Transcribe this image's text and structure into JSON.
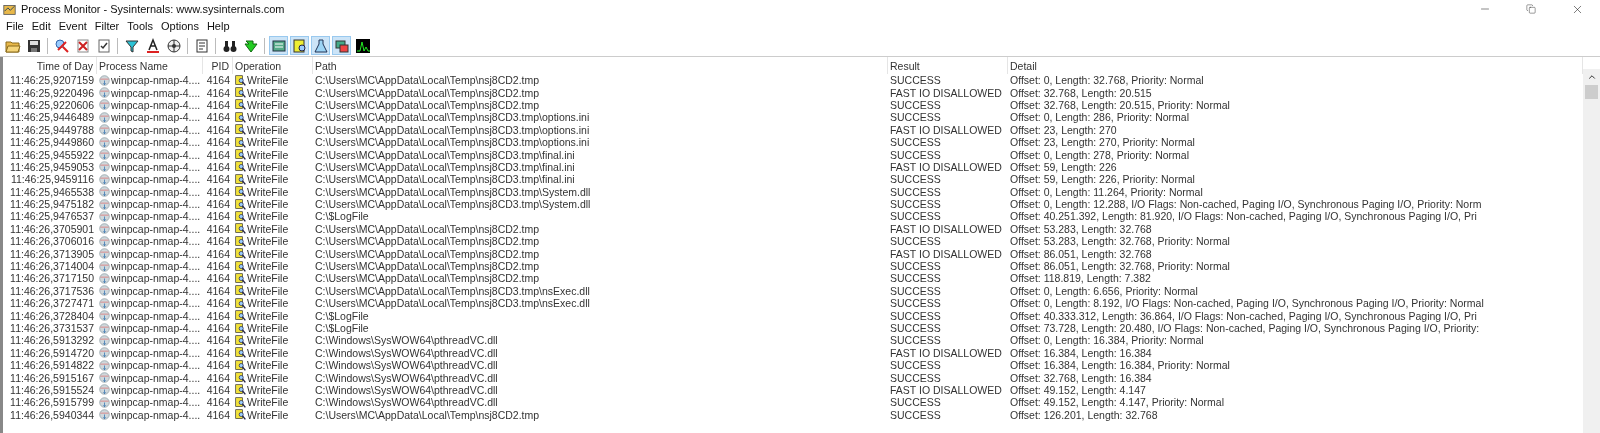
{
  "window": {
    "title": "Process Monitor - Sysinternals: www.sysinternals.com"
  },
  "menu": [
    "File",
    "Edit",
    "Event",
    "Filter",
    "Tools",
    "Options",
    "Help"
  ],
  "event_class_filters": [
    {
      "selected": true
    },
    {
      "selected": true
    },
    {
      "selected": true
    },
    {
      "selected": true
    },
    {
      "selected": false
    }
  ],
  "table": {
    "columns": [
      "Time of Day",
      "Process Name",
      "PID",
      "Operation",
      "Path",
      "Result",
      "Detail"
    ],
    "rows": [
      {
        "time": "11:46:25,9207159",
        "process": "winpcap-nmap-4....",
        "pid": "4164",
        "operation": "WriteFile",
        "path": "C:\\Users\\MC\\AppData\\Local\\Temp\\nsj8CD2.tmp",
        "result": "SUCCESS",
        "detail": "Offset: 0, Length: 32.768, Priority: Normal"
      },
      {
        "time": "11:46:25,9220496",
        "process": "winpcap-nmap-4....",
        "pid": "4164",
        "operation": "WriteFile",
        "path": "C:\\Users\\MC\\AppData\\Local\\Temp\\nsj8CD2.tmp",
        "result": "FAST IO DISALLOWED",
        "detail": "Offset: 32.768, Length: 20.515"
      },
      {
        "time": "11:46:25,9220606",
        "process": "winpcap-nmap-4....",
        "pid": "4164",
        "operation": "WriteFile",
        "path": "C:\\Users\\MC\\AppData\\Local\\Temp\\nsj8CD2.tmp",
        "result": "SUCCESS",
        "detail": "Offset: 32.768, Length: 20.515, Priority: Normal"
      },
      {
        "time": "11:46:25,9446489",
        "process": "winpcap-nmap-4....",
        "pid": "4164",
        "operation": "WriteFile",
        "path": "C:\\Users\\MC\\AppData\\Local\\Temp\\nsj8CD3.tmp\\options.ini",
        "result": "SUCCESS",
        "detail": "Offset: 0, Length: 286, Priority: Normal"
      },
      {
        "time": "11:46:25,9449788",
        "process": "winpcap-nmap-4....",
        "pid": "4164",
        "operation": "WriteFile",
        "path": "C:\\Users\\MC\\AppData\\Local\\Temp\\nsj8CD3.tmp\\options.ini",
        "result": "FAST IO DISALLOWED",
        "detail": "Offset: 23, Length: 270"
      },
      {
        "time": "11:46:25,9449860",
        "process": "winpcap-nmap-4....",
        "pid": "4164",
        "operation": "WriteFile",
        "path": "C:\\Users\\MC\\AppData\\Local\\Temp\\nsj8CD3.tmp\\options.ini",
        "result": "SUCCESS",
        "detail": "Offset: 23, Length: 270, Priority: Normal"
      },
      {
        "time": "11:46:25,9455922",
        "process": "winpcap-nmap-4....",
        "pid": "4164",
        "operation": "WriteFile",
        "path": "C:\\Users\\MC\\AppData\\Local\\Temp\\nsj8CD3.tmp\\final.ini",
        "result": "SUCCESS",
        "detail": "Offset: 0, Length: 278, Priority: Normal"
      },
      {
        "time": "11:46:25,9459053",
        "process": "winpcap-nmap-4....",
        "pid": "4164",
        "operation": "WriteFile",
        "path": "C:\\Users\\MC\\AppData\\Local\\Temp\\nsj8CD3.tmp\\final.ini",
        "result": "FAST IO DISALLOWED",
        "detail": "Offset: 59, Length: 226"
      },
      {
        "time": "11:46:25,9459116",
        "process": "winpcap-nmap-4....",
        "pid": "4164",
        "operation": "WriteFile",
        "path": "C:\\Users\\MC\\AppData\\Local\\Temp\\nsj8CD3.tmp\\final.ini",
        "result": "SUCCESS",
        "detail": "Offset: 59, Length: 226, Priority: Normal"
      },
      {
        "time": "11:46:25,9465538",
        "process": "winpcap-nmap-4....",
        "pid": "4164",
        "operation": "WriteFile",
        "path": "C:\\Users\\MC\\AppData\\Local\\Temp\\nsj8CD3.tmp\\System.dll",
        "result": "SUCCESS",
        "detail": "Offset: 0, Length: 11.264, Priority: Normal"
      },
      {
        "time": "11:46:25,9475182",
        "process": "winpcap-nmap-4....",
        "pid": "4164",
        "operation": "WriteFile",
        "path": "C:\\Users\\MC\\AppData\\Local\\Temp\\nsj8CD3.tmp\\System.dll",
        "result": "SUCCESS",
        "detail": "Offset: 0, Length: 12.288, I/O Flags: Non-cached, Paging I/O, Synchronous Paging I/O, Priority: Norm"
      },
      {
        "time": "11:46:25,9476537",
        "process": "winpcap-nmap-4....",
        "pid": "4164",
        "operation": "WriteFile",
        "path": "C:\\$LogFile",
        "result": "SUCCESS",
        "detail": "Offset: 40.251.392, Length: 81.920, I/O Flags: Non-cached, Paging I/O, Synchronous Paging I/O, Pri"
      },
      {
        "time": "11:46:26,3705901",
        "process": "winpcap-nmap-4....",
        "pid": "4164",
        "operation": "WriteFile",
        "path": "C:\\Users\\MC\\AppData\\Local\\Temp\\nsj8CD2.tmp",
        "result": "FAST IO DISALLOWED",
        "detail": "Offset: 53.283, Length: 32.768"
      },
      {
        "time": "11:46:26,3706016",
        "process": "winpcap-nmap-4....",
        "pid": "4164",
        "operation": "WriteFile",
        "path": "C:\\Users\\MC\\AppData\\Local\\Temp\\nsj8CD2.tmp",
        "result": "SUCCESS",
        "detail": "Offset: 53.283, Length: 32.768, Priority: Normal"
      },
      {
        "time": "11:46:26,3713905",
        "process": "winpcap-nmap-4....",
        "pid": "4164",
        "operation": "WriteFile",
        "path": "C:\\Users\\MC\\AppData\\Local\\Temp\\nsj8CD2.tmp",
        "result": "FAST IO DISALLOWED",
        "detail": "Offset: 86.051, Length: 32.768"
      },
      {
        "time": "11:46:26,3714004",
        "process": "winpcap-nmap-4....",
        "pid": "4164",
        "operation": "WriteFile",
        "path": "C:\\Users\\MC\\AppData\\Local\\Temp\\nsj8CD2.tmp",
        "result": "SUCCESS",
        "detail": "Offset: 86.051, Length: 32.768, Priority: Normal"
      },
      {
        "time": "11:46:26,3717150",
        "process": "winpcap-nmap-4....",
        "pid": "4164",
        "operation": "WriteFile",
        "path": "C:\\Users\\MC\\AppData\\Local\\Temp\\nsj8CD2.tmp",
        "result": "SUCCESS",
        "detail": "Offset: 118.819, Length: 7.382"
      },
      {
        "time": "11:46:26,3717536",
        "process": "winpcap-nmap-4....",
        "pid": "4164",
        "operation": "WriteFile",
        "path": "C:\\Users\\MC\\AppData\\Local\\Temp\\nsj8CD3.tmp\\nsExec.dll",
        "result": "SUCCESS",
        "detail": "Offset: 0, Length: 6.656, Priority: Normal"
      },
      {
        "time": "11:46:26,3727471",
        "process": "winpcap-nmap-4....",
        "pid": "4164",
        "operation": "WriteFile",
        "path": "C:\\Users\\MC\\AppData\\Local\\Temp\\nsj8CD3.tmp\\nsExec.dll",
        "result": "SUCCESS",
        "detail": "Offset: 0, Length: 8.192, I/O Flags: Non-cached, Paging I/O, Synchronous Paging I/O, Priority: Normal"
      },
      {
        "time": "11:46:26,3728404",
        "process": "winpcap-nmap-4....",
        "pid": "4164",
        "operation": "WriteFile",
        "path": "C:\\$LogFile",
        "result": "SUCCESS",
        "detail": "Offset: 40.333.312, Length: 36.864, I/O Flags: Non-cached, Paging I/O, Synchronous Paging I/O, Pri"
      },
      {
        "time": "11:46:26,3731537",
        "process": "winpcap-nmap-4....",
        "pid": "4164",
        "operation": "WriteFile",
        "path": "C:\\$LogFile",
        "result": "SUCCESS",
        "detail": "Offset: 73.728, Length: 20.480, I/O Flags: Non-cached, Paging I/O, Synchronous Paging I/O, Priority:"
      },
      {
        "time": "11:46:26,5913292",
        "process": "winpcap-nmap-4....",
        "pid": "4164",
        "operation": "WriteFile",
        "path": "C:\\Windows\\SysWOW64\\pthreadVC.dll",
        "result": "SUCCESS",
        "detail": "Offset: 0, Length: 16.384, Priority: Normal"
      },
      {
        "time": "11:46:26,5914720",
        "process": "winpcap-nmap-4....",
        "pid": "4164",
        "operation": "WriteFile",
        "path": "C:\\Windows\\SysWOW64\\pthreadVC.dll",
        "result": "FAST IO DISALLOWED",
        "detail": "Offset: 16.384, Length: 16.384"
      },
      {
        "time": "11:46:26,5914822",
        "process": "winpcap-nmap-4....",
        "pid": "4164",
        "operation": "WriteFile",
        "path": "C:\\Windows\\SysWOW64\\pthreadVC.dll",
        "result": "SUCCESS",
        "detail": "Offset: 16.384, Length: 16.384, Priority: Normal"
      },
      {
        "time": "11:46:26,5915167",
        "process": "winpcap-nmap-4....",
        "pid": "4164",
        "operation": "WriteFile",
        "path": "C:\\Windows\\SysWOW64\\pthreadVC.dll",
        "result": "SUCCESS",
        "detail": "Offset: 32.768, Length: 16.384"
      },
      {
        "time": "11:46:26,5915524",
        "process": "winpcap-nmap-4....",
        "pid": "4164",
        "operation": "WriteFile",
        "path": "C:\\Windows\\SysWOW64\\pthreadVC.dll",
        "result": "FAST IO DISALLOWED",
        "detail": "Offset: 49.152, Length: 4.147"
      },
      {
        "time": "11:46:26,5915799",
        "process": "winpcap-nmap-4....",
        "pid": "4164",
        "operation": "WriteFile",
        "path": "C:\\Windows\\SysWOW64\\pthreadVC.dll",
        "result": "SUCCESS",
        "detail": "Offset: 49.152, Length: 4.147, Priority: Normal"
      },
      {
        "time": "11:46:26,5940344",
        "process": "winpcap-nmap-4....",
        "pid": "4164",
        "operation": "WriteFile",
        "path": "C:\\Users\\MC\\AppData\\Local\\Temp\\nsj8CD2.tmp",
        "result": "SUCCESS",
        "detail": "Offset: 126.201, Length: 32.768"
      }
    ]
  }
}
